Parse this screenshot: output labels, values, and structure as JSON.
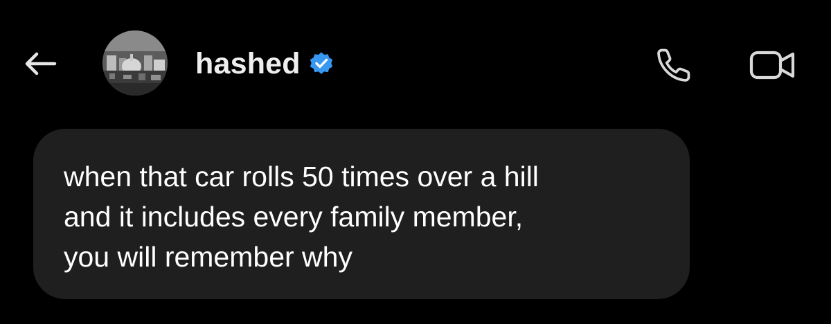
{
  "header": {
    "back_icon": "arrow-left-icon",
    "avatar_icon": "profile-photo-cityscape",
    "contact_name": "hashed",
    "verified_icon": "verified-badge-icon",
    "call_icon": "phone-icon",
    "video_icon": "video-camera-icon"
  },
  "message": {
    "lines": [
      "when that car rolls 50 times over a hill",
      "and it includes every family member,",
      "you will remember why"
    ]
  },
  "colors": {
    "background": "#000000",
    "bubble": "#1f1f1f",
    "text": "#ffffff",
    "icon": "#d9d9d9",
    "verified": "#3897f0"
  }
}
